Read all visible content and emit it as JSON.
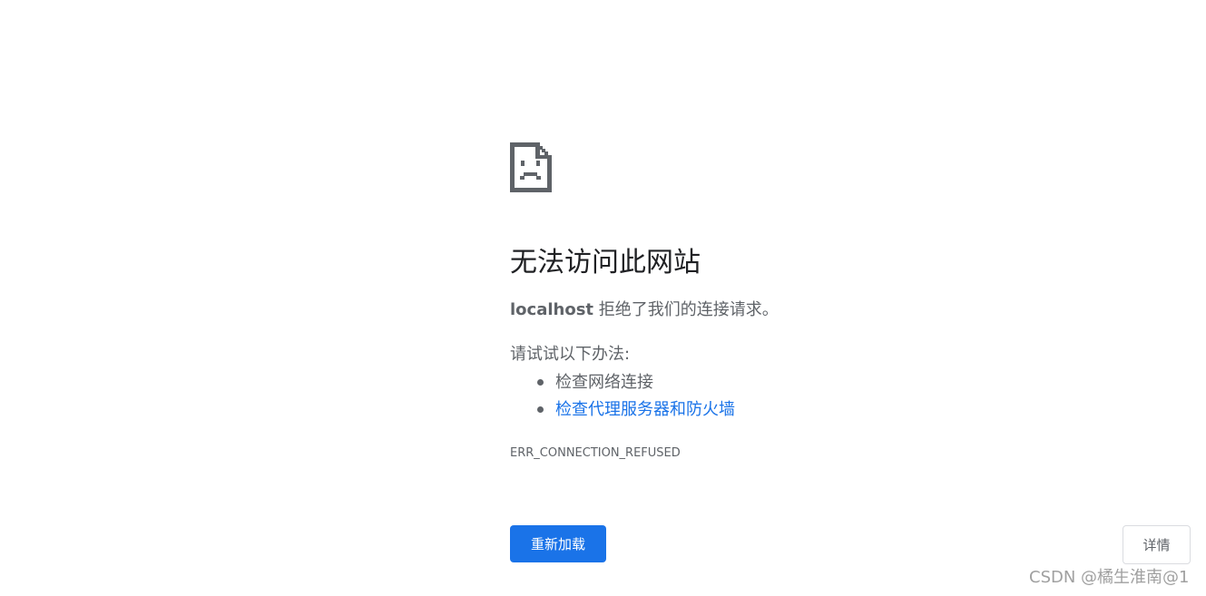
{
  "error": {
    "icon": "sad-page-icon",
    "title": "无法访问此网站",
    "host": "localhost",
    "summary": " 拒绝了我们的连接请求。",
    "suggestions_heading": "请试试以下办法:",
    "suggestions": [
      {
        "label": "检查网络连接",
        "link": false
      },
      {
        "label": "检查代理服务器和防火墙",
        "link": true
      }
    ],
    "code": "ERR_CONNECTION_REFUSED"
  },
  "buttons": {
    "reload": "重新加载",
    "details": "详情"
  },
  "watermark": "CSDN @橘生淮南@1",
  "colors": {
    "title": "#202124",
    "text": "#5f6368",
    "link": "#1a73e8",
    "primary_button": "#1a73e8",
    "watermark": "#a0a0a0"
  }
}
